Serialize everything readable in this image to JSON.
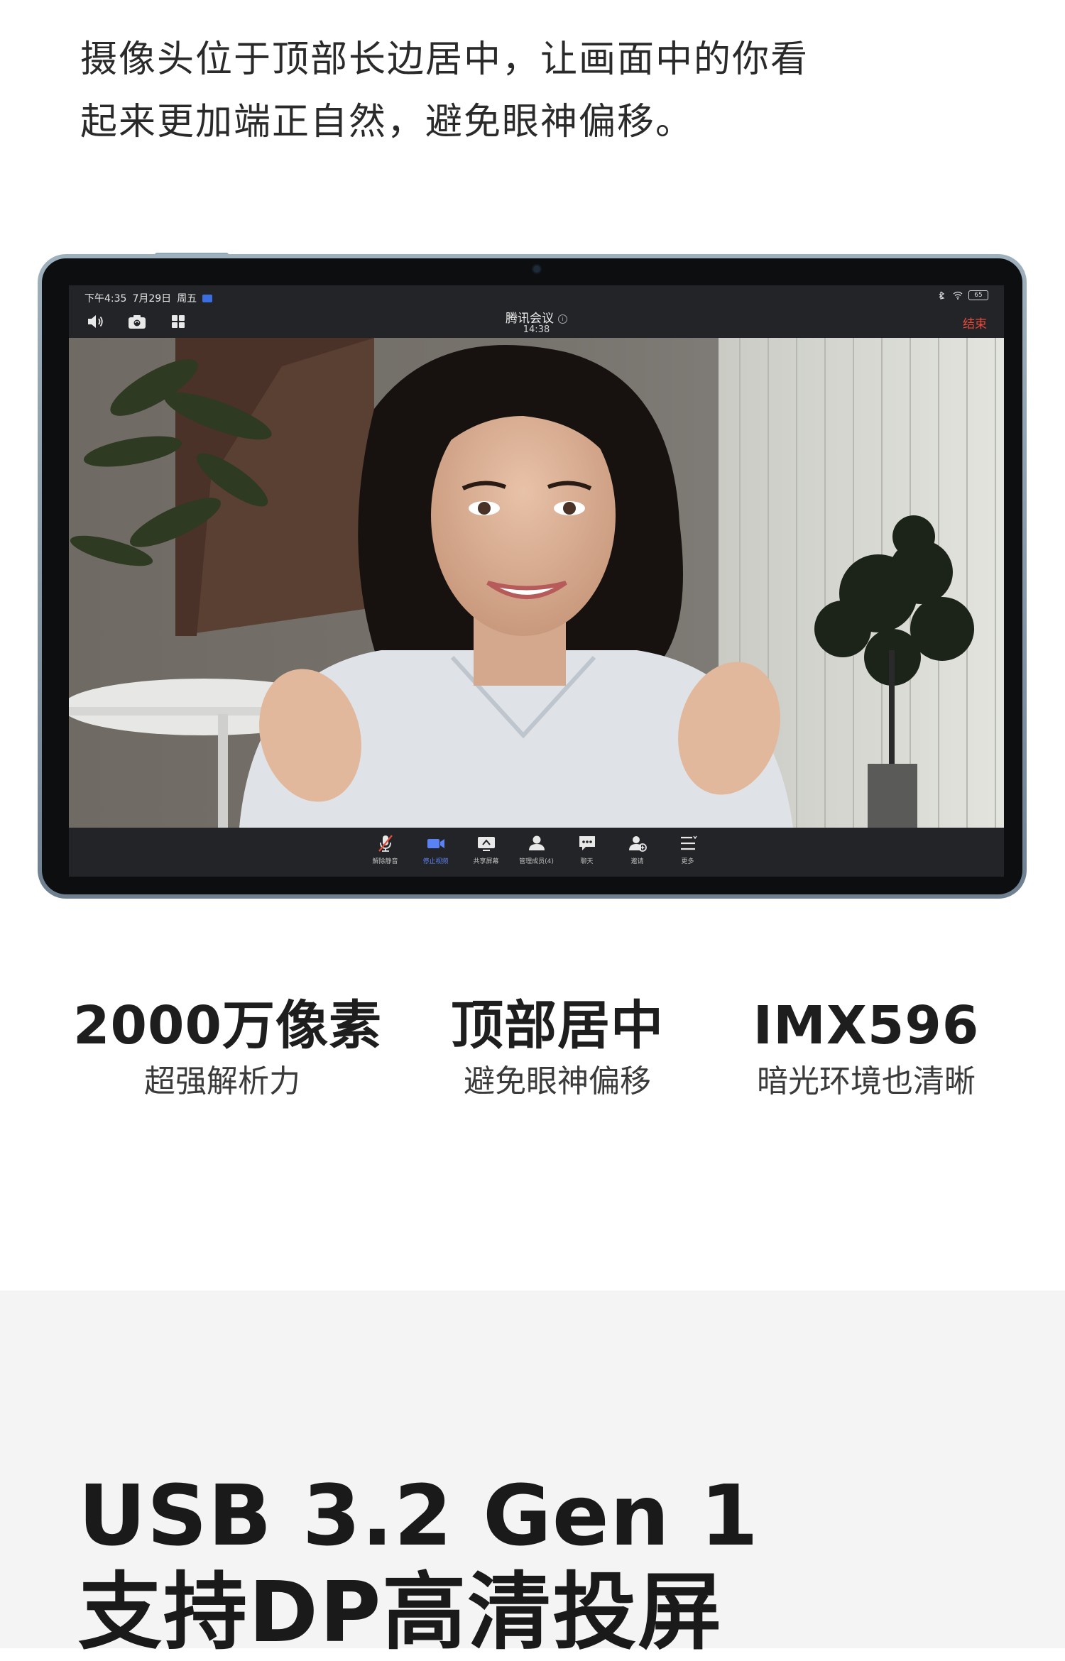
{
  "intro": {
    "line1": "摄像头位于顶部长边居中，让画面中的你看",
    "line2": "起来更加端正自然，避免眼神偏移。"
  },
  "tablet": {
    "statusbar": {
      "time": "下午4:35",
      "date": "7月29日",
      "weekday": "周五",
      "battery": "65"
    },
    "topbar": {
      "icons": [
        "speaker-icon",
        "camera-switch-icon",
        "grid-layout-icon"
      ],
      "meeting_title": "腾讯会议",
      "meeting_clock": "14:38",
      "end_label": "结束"
    },
    "toolbar": [
      {
        "label": "解除静音",
        "icon": "mic-muted-icon",
        "active": false
      },
      {
        "label": "停止视频",
        "icon": "video-camera-icon",
        "active": true
      },
      {
        "label": "共享屏幕",
        "icon": "share-screen-icon",
        "active": false
      },
      {
        "label": "管理成员(4)",
        "icon": "members-icon",
        "active": false
      },
      {
        "label": "聊天",
        "icon": "chat-icon",
        "active": false
      },
      {
        "label": "邀请",
        "icon": "invite-icon",
        "active": false
      },
      {
        "label": "更多",
        "icon": "more-icon",
        "active": false
      }
    ],
    "accent_color": "#5b82f5",
    "end_color": "#e64b3c"
  },
  "features": [
    {
      "title": "2000万像素",
      "subtitle": "超强解析力"
    },
    {
      "title": "顶部居中",
      "subtitle": "避免眼神偏移"
    },
    {
      "title": "IMX596",
      "subtitle": "暗光环境也清晰"
    }
  ],
  "usb": {
    "title": "USB 3.2 Gen 1",
    "subtitle": "支持DP高清投屏"
  }
}
